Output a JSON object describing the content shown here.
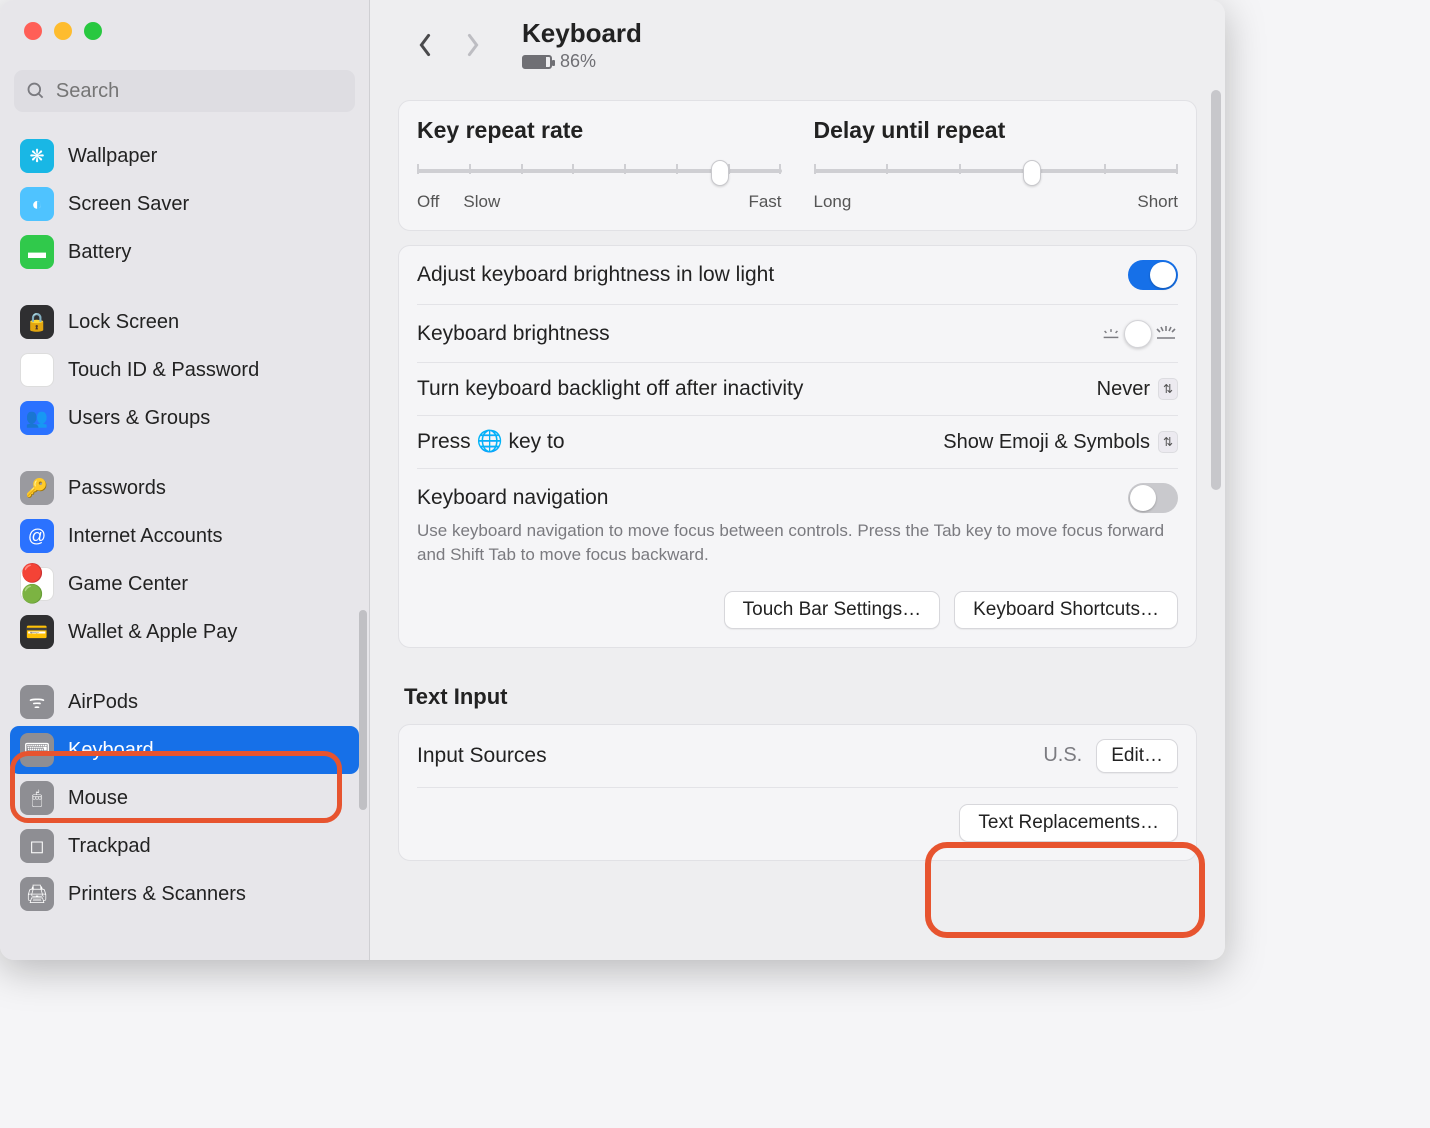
{
  "header": {
    "title": "Keyboard",
    "battery_pct": "86%"
  },
  "search": {
    "placeholder": "Search"
  },
  "sidebar": {
    "items": [
      {
        "label": "Wallpaper"
      },
      {
        "label": "Screen Saver"
      },
      {
        "label": "Battery"
      },
      {
        "label": "Lock Screen"
      },
      {
        "label": "Touch ID & Password"
      },
      {
        "label": "Users & Groups"
      },
      {
        "label": "Passwords"
      },
      {
        "label": "Internet Accounts"
      },
      {
        "label": "Game Center"
      },
      {
        "label": "Wallet & Apple Pay"
      },
      {
        "label": "AirPods"
      },
      {
        "label": "Keyboard"
      },
      {
        "label": "Mouse"
      },
      {
        "label": "Trackpad"
      },
      {
        "label": "Printers & Scanners"
      }
    ]
  },
  "repeat": {
    "rate_label": "Key repeat rate",
    "off": "Off",
    "slow": "Slow",
    "fast": "Fast",
    "delay_label": "Delay until repeat",
    "long": "Long",
    "short": "Short"
  },
  "bright": {
    "auto_label": "Adjust keyboard brightness in low light",
    "level_label": "Keyboard brightness",
    "off_label": "Turn keyboard backlight off after inactivity",
    "off_value": "Never",
    "press_label": "Press 🌐 key to",
    "press_value": "Show Emoji & Symbols",
    "nav_label": "Keyboard navigation",
    "nav_desc": "Use keyboard navigation to move focus between controls. Press the Tab key to move focus forward and Shift Tab to move focus backward."
  },
  "buttons": {
    "touchbar": "Touch Bar Settings…",
    "shortcuts": "Keyboard Shortcuts…",
    "edit": "Edit…",
    "textrepl": "Text Replacements…"
  },
  "textinput": {
    "title": "Text Input",
    "sources_label": "Input Sources",
    "sources_value": "U.S."
  }
}
